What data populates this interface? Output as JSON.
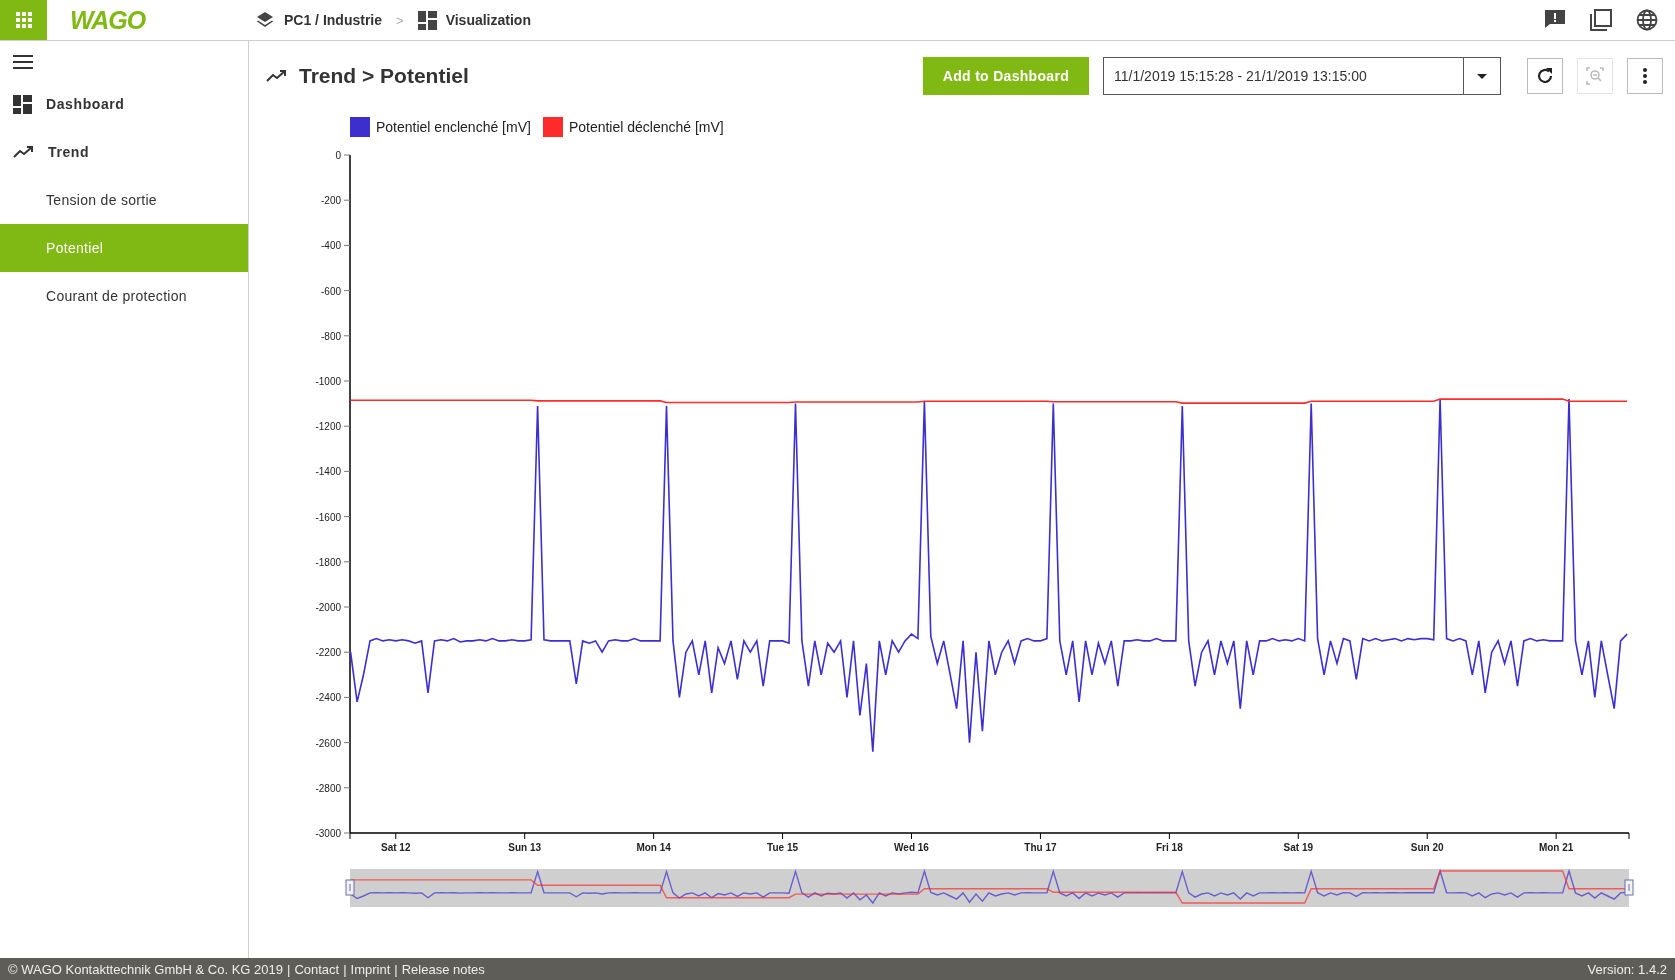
{
  "header": {
    "logo": "WAGO",
    "breadcrumb": [
      {
        "label": "PC1 / Industrie"
      },
      {
        "label": "Visualization"
      }
    ],
    "separator": ">"
  },
  "sidebar": {
    "items": [
      {
        "label": "Dashboard",
        "selected": false
      },
      {
        "label": "Trend",
        "selected": false,
        "children": [
          {
            "label": "Tension de sortie",
            "selected": false
          },
          {
            "label": "Potentiel",
            "selected": true
          },
          {
            "label": "Courant de protection",
            "selected": false
          }
        ]
      }
    ]
  },
  "page": {
    "title": "Trend > Potentiel",
    "add_button": "Add to Dashboard",
    "date_range": "11/1/2019 15:15:28 - 21/1/2019 13:15:00",
    "zoom_out_disabled": true,
    "chart_data": {
      "type": "line",
      "ylim": [
        -3000,
        0
      ],
      "yticks": [
        0,
        -200,
        -400,
        -600,
        -800,
        -1000,
        -1200,
        -1400,
        -1600,
        -1800,
        -2000,
        -2200,
        -2400,
        -2600,
        -2800,
        -3000
      ],
      "categories": [
        null,
        null,
        null,
        null,
        null,
        null,
        null,
        "Sat 12",
        null,
        null,
        null,
        null,
        null,
        null,
        null,
        null,
        null,
        null,
        null,
        null,
        null,
        null,
        null,
        null,
        null,
        null,
        null,
        "Sun 13",
        null,
        null,
        null,
        null,
        null,
        null,
        null,
        null,
        null,
        null,
        null,
        null,
        null,
        null,
        null,
        null,
        null,
        null,
        null,
        "Mon 14",
        null,
        null,
        null,
        null,
        null,
        null,
        null,
        null,
        null,
        null,
        null,
        null,
        null,
        null,
        null,
        null,
        null,
        null,
        null,
        "Tue 15",
        null,
        null,
        null,
        null,
        null,
        null,
        null,
        null,
        null,
        null,
        null,
        null,
        null,
        null,
        null,
        null,
        null,
        null,
        null,
        "Wed 16",
        null,
        null,
        null,
        null,
        null,
        null,
        null,
        null,
        null,
        null,
        null,
        null,
        null,
        null,
        null,
        null,
        null,
        null,
        null,
        "Thu 17",
        null,
        null,
        null,
        null,
        null,
        null,
        null,
        null,
        null,
        null,
        null,
        null,
        null,
        null,
        null,
        null,
        null,
        null,
        null,
        "Fri 18",
        null,
        null,
        null,
        null,
        null,
        null,
        null,
        null,
        null,
        null,
        null,
        null,
        null,
        null,
        null,
        null,
        null,
        null,
        null,
        "Sat 19",
        null,
        null,
        null,
        null,
        null,
        null,
        null,
        null,
        null,
        null,
        null,
        null,
        null,
        null,
        null,
        null,
        null,
        null,
        null,
        "Sun 20",
        null,
        null,
        null,
        null,
        null,
        null,
        null,
        null,
        null,
        null,
        null,
        null,
        null,
        null,
        null,
        null,
        null,
        null,
        null,
        "Mon 21",
        null,
        null,
        null,
        null,
        null,
        null,
        null,
        null,
        null,
        null,
        null
      ],
      "series": [
        {
          "name": "Potentiel enclenché [mV]",
          "color": "#3b2fd0",
          "values": [
            -2200,
            -2420,
            -2300,
            -2150,
            -2140,
            -2150,
            -2145,
            -2150,
            -2145,
            -2150,
            -2160,
            -2150,
            -2380,
            -2150,
            -2145,
            -2150,
            -2140,
            -2155,
            -2150,
            -2150,
            -2145,
            -2150,
            -2140,
            -2150,
            -2150,
            -2145,
            -2150,
            -2150,
            -2145,
            -1110,
            -2145,
            -2150,
            -2150,
            -2150,
            -2150,
            -2340,
            -2150,
            -2160,
            -2150,
            -2200,
            -2150,
            -2145,
            -2150,
            -2150,
            -2140,
            -2150,
            -2150,
            -2150,
            -2150,
            -1110,
            -2150,
            -2400,
            -2200,
            -2150,
            -2300,
            -2150,
            -2380,
            -2180,
            -2250,
            -2150,
            -2320,
            -2150,
            -2200,
            -2150,
            -2350,
            -2150,
            -2150,
            -2150,
            -2160,
            -1100,
            -2150,
            -2350,
            -2150,
            -2300,
            -2160,
            -2200,
            -2150,
            -2400,
            -2150,
            -2480,
            -2250,
            -2640,
            -2150,
            -2300,
            -2150,
            -2200,
            -2150,
            -2120,
            -2140,
            -1090,
            -2130,
            -2250,
            -2150,
            -2300,
            -2450,
            -2150,
            -2600,
            -2200,
            -2550,
            -2150,
            -2300,
            -2200,
            -2150,
            -2250,
            -2150,
            -2140,
            -2150,
            -2150,
            -2140,
            -1100,
            -2150,
            -2300,
            -2150,
            -2420,
            -2150,
            -2300,
            -2160,
            -2250,
            -2150,
            -2350,
            -2150,
            -2150,
            -2145,
            -2150,
            -2150,
            -2140,
            -2150,
            -2150,
            -2150,
            -1110,
            -2150,
            -2350,
            -2200,
            -2150,
            -2300,
            -2150,
            -2250,
            -2150,
            -2450,
            -2150,
            -2300,
            -2150,
            -2150,
            -2140,
            -2150,
            -2145,
            -2150,
            -2140,
            -2150,
            -1100,
            -2140,
            -2300,
            -2150,
            -2250,
            -2140,
            -2150,
            -2320,
            -2140,
            -2150,
            -2140,
            -2150,
            -2145,
            -2140,
            -2150,
            -2140,
            -2145,
            -2140,
            -2140,
            -2145,
            -1080,
            -2140,
            -2150,
            -2140,
            -2150,
            -2300,
            -2150,
            -2380,
            -2200,
            -2150,
            -2250,
            -2150,
            -2350,
            -2150,
            -2140,
            -2150,
            -2145,
            -2150,
            -2150,
            -2150,
            -1080,
            -2150,
            -2300,
            -2150,
            -2400,
            -2150,
            -2300,
            -2450,
            -2150,
            -2120
          ]
        },
        {
          "name": "Potentiel déclenché [mV]",
          "color": "#ff2a2a",
          "values": [
            -1085,
            -1085,
            -1085,
            -1085,
            -1085,
            -1085,
            -1085,
            -1085,
            -1085,
            -1085,
            -1085,
            -1085,
            -1085,
            -1085,
            -1085,
            -1085,
            -1085,
            -1085,
            -1085,
            -1085,
            -1085,
            -1085,
            -1085,
            -1085,
            -1085,
            -1085,
            -1085,
            -1085,
            -1085,
            -1088,
            -1088,
            -1088,
            -1088,
            -1088,
            -1088,
            -1088,
            -1088,
            -1088,
            -1088,
            -1088,
            -1088,
            -1088,
            -1088,
            -1088,
            -1088,
            -1088,
            -1088,
            -1088,
            -1088,
            -1095,
            -1095,
            -1095,
            -1095,
            -1095,
            -1095,
            -1095,
            -1095,
            -1095,
            -1095,
            -1095,
            -1095,
            -1095,
            -1095,
            -1095,
            -1095,
            -1095,
            -1095,
            -1095,
            -1095,
            -1093,
            -1093,
            -1093,
            -1093,
            -1093,
            -1093,
            -1093,
            -1093,
            -1093,
            -1093,
            -1093,
            -1093,
            -1093,
            -1093,
            -1093,
            -1093,
            -1093,
            -1093,
            -1093,
            -1093,
            -1090,
            -1090,
            -1090,
            -1090,
            -1090,
            -1090,
            -1090,
            -1090,
            -1090,
            -1090,
            -1090,
            -1090,
            -1090,
            -1090,
            -1090,
            -1090,
            -1090,
            -1090,
            -1090,
            -1090,
            -1092,
            -1092,
            -1092,
            -1092,
            -1092,
            -1092,
            -1092,
            -1092,
            -1092,
            -1092,
            -1092,
            -1092,
            -1092,
            -1092,
            -1092,
            -1092,
            -1092,
            -1092,
            -1092,
            -1092,
            -1098,
            -1098,
            -1098,
            -1098,
            -1098,
            -1098,
            -1098,
            -1098,
            -1098,
            -1098,
            -1098,
            -1098,
            -1098,
            -1098,
            -1098,
            -1098,
            -1098,
            -1098,
            -1098,
            -1098,
            -1090,
            -1090,
            -1090,
            -1090,
            -1090,
            -1090,
            -1090,
            -1090,
            -1090,
            -1090,
            -1090,
            -1090,
            -1090,
            -1090,
            -1090,
            -1090,
            -1090,
            -1090,
            -1090,
            -1090,
            -1080,
            -1080,
            -1080,
            -1080,
            -1080,
            -1080,
            -1080,
            -1080,
            -1080,
            -1080,
            -1080,
            -1080,
            -1080,
            -1080,
            -1080,
            -1080,
            -1080,
            -1080,
            -1080,
            -1080,
            -1090,
            -1090,
            -1090,
            -1090,
            -1090,
            -1090,
            -1090,
            -1090,
            -1090,
            -1090
          ]
        }
      ]
    }
  },
  "footer": {
    "copyright": "© WAGO Kontakttechnik GmbH & Co. KG 2019",
    "link_separator": "|",
    "links": [
      "Contact",
      "Imprint",
      "Release notes"
    ],
    "version": "Version: 1.4.2"
  }
}
